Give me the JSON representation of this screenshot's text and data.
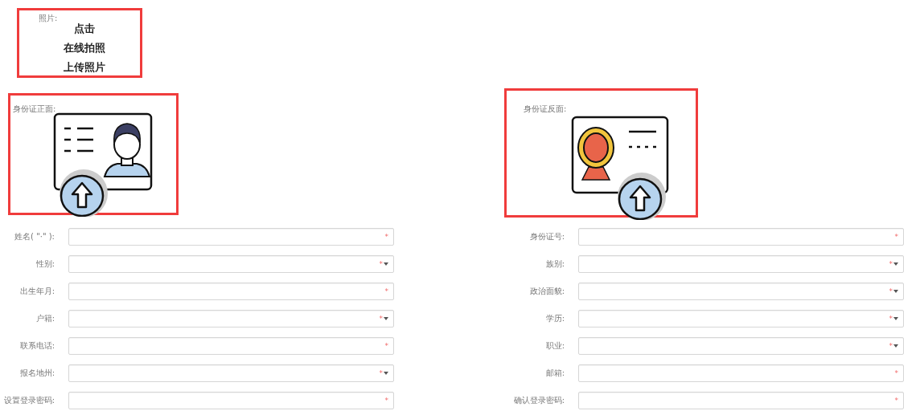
{
  "photo": {
    "label": "照片:",
    "button_lines": [
      "点击",
      "在线拍照",
      "上传照片"
    ],
    "highlighted": true
  },
  "id_cards": [
    {
      "label": "身份证正面:",
      "kind": "front",
      "highlighted": true
    },
    {
      "label": "身份证反面:",
      "kind": "back",
      "highlighted": true
    }
  ],
  "form_columns": [
    [
      {
        "label": "姓名( \"·\" ):",
        "kind": "text",
        "required_mark": "*"
      },
      {
        "label": "性别:",
        "kind": "select",
        "required_mark": "*"
      },
      {
        "label": "出生年月:",
        "kind": "text",
        "required_mark": "*"
      },
      {
        "label": "户籍:",
        "kind": "select",
        "required_mark": "*"
      },
      {
        "label": "联系电话:",
        "kind": "text",
        "required_mark": "*"
      },
      {
        "label": "报名地州:",
        "kind": "select",
        "required_mark": "*"
      },
      {
        "label": "设置登录密码:",
        "kind": "text",
        "required_mark": "*"
      }
    ],
    [
      {
        "label": "身份证号:",
        "kind": "text",
        "required_mark": "*"
      },
      {
        "label": "族别:",
        "kind": "select",
        "required_mark": "*"
      },
      {
        "label": "政治面貌:",
        "kind": "select",
        "required_mark": "*"
      },
      {
        "label": "学历:",
        "kind": "select",
        "required_mark": "*"
      },
      {
        "label": "职业:",
        "kind": "select",
        "required_mark": "*"
      },
      {
        "label": "邮箱:",
        "kind": "text",
        "required_mark": "*"
      },
      {
        "label": "确认登录密码:",
        "kind": "text",
        "required_mark": "*"
      }
    ]
  ]
}
